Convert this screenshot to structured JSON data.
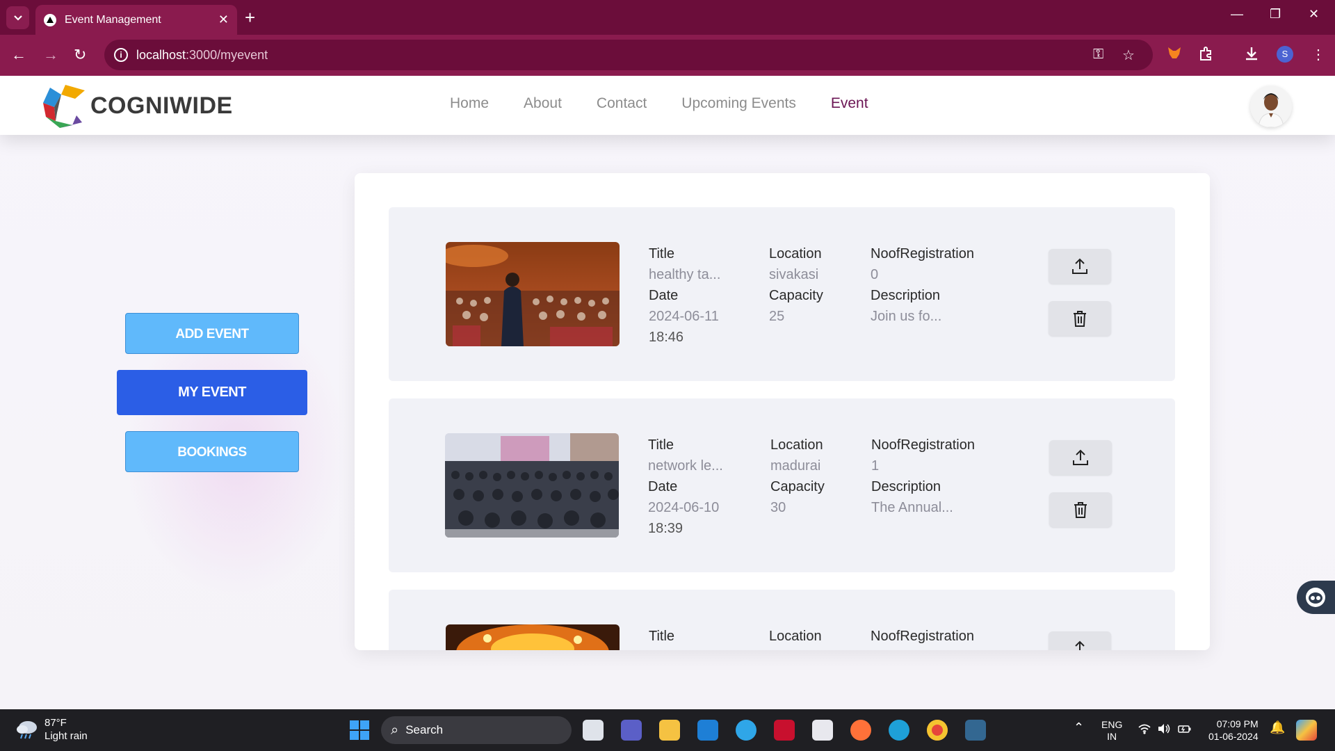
{
  "browser": {
    "tab_title": "Event Management",
    "url_host": "localhost",
    "url_path": ":3000/myevent",
    "profile_initial": "S"
  },
  "site": {
    "logo_text": "COGNIWIDE",
    "nav": [
      "Home",
      "About",
      "Contact",
      "Upcoming Events",
      "Event"
    ],
    "active_nav": "Event"
  },
  "sidebar": {
    "add_event": "ADD EVENT",
    "my_event": "MY EVENT",
    "bookings": "BOOKINGS"
  },
  "labels": {
    "title": "Title",
    "location": "Location",
    "registrations": "NoofRegistration",
    "date": "Date",
    "capacity": "Capacity",
    "description": "Description"
  },
  "events": [
    {
      "title": "healthy ta...",
      "location": "sivakasi",
      "registrations": "0",
      "date": "2024-06-11",
      "time": "18:46",
      "capacity": "25",
      "description": "Join us fo..."
    },
    {
      "title": "network le...",
      "location": "madurai",
      "registrations": "1",
      "date": "2024-06-10",
      "time": "18:39",
      "capacity": "30",
      "description": "The Annual..."
    },
    {
      "title": "",
      "location": "",
      "registrations": "",
      "date": "",
      "time": "",
      "capacity": "",
      "description": ""
    }
  ],
  "taskbar": {
    "temperature": "87°F",
    "weather": "Light rain",
    "search": "Search",
    "lang1": "ENG",
    "lang2": "IN",
    "time": "07:09 PM",
    "date": "01-06-2024"
  },
  "colors": {
    "browser_frame": "#6b0d3a",
    "nav_active": "#6b1554",
    "primary_button": "#2b5ee6",
    "secondary_button": "#60b9fb"
  }
}
